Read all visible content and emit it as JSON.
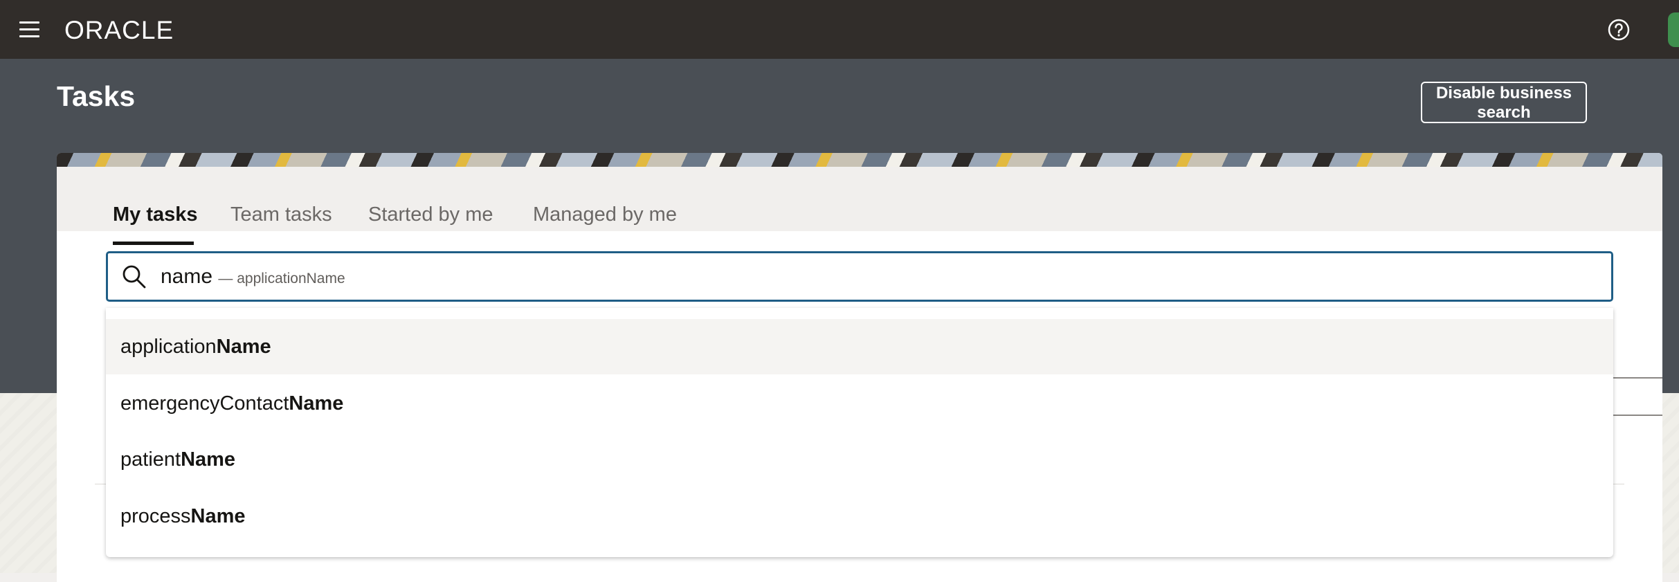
{
  "topbar": {
    "logo_text": "ORACLE",
    "menu_icon": "hamburger-menu-icon",
    "help_icon": "help-circle-icon",
    "avatar_icon": "user-avatar-icon"
  },
  "page": {
    "title": "Tasks",
    "disable_button_label": "Disable business search"
  },
  "tabs": [
    {
      "label": "My tasks",
      "active": true
    },
    {
      "label": "Team tasks",
      "active": false
    },
    {
      "label": "Started by me",
      "active": false
    },
    {
      "label": "Managed by me",
      "active": false
    }
  ],
  "search": {
    "value": "name",
    "hint": "— applicationName",
    "icon": "search-icon"
  },
  "suggestions": [
    {
      "prefix": "application",
      "match": "Name"
    },
    {
      "prefix": "emergencyContact",
      "match": "Name"
    },
    {
      "prefix": "patient",
      "match": "Name"
    },
    {
      "prefix": "process",
      "match": "Name"
    }
  ],
  "colors": {
    "topbar": "#312d2a",
    "header_band": "#4a4f55",
    "focus_border": "#1f5e86",
    "avatar": "#3f8f4e"
  }
}
